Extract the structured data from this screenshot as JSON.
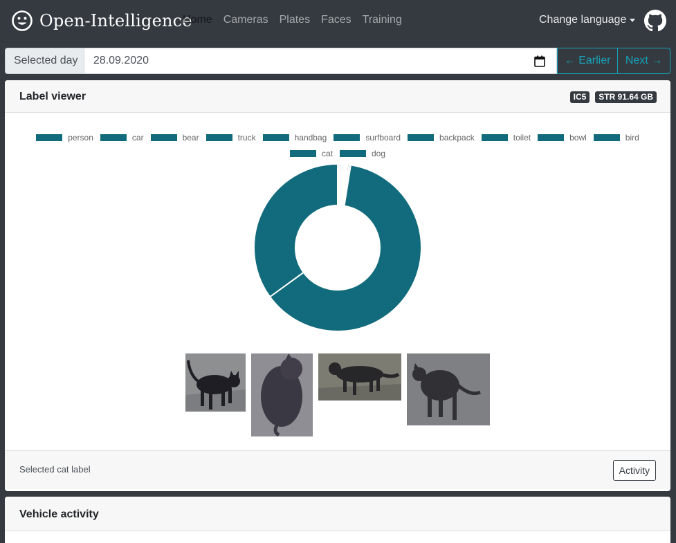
{
  "navbar": {
    "brand": "Open-Intelligence",
    "brand_icon": "smiley-face-icon",
    "links": [
      "Home",
      "Cameras",
      "Plates",
      "Faces",
      "Training"
    ],
    "active_link": "Home",
    "language_label": "Change language",
    "github_icon": "github-icon"
  },
  "date_bar": {
    "prefix": "Selected day",
    "value": "28.09.2020",
    "earlier_label": "← Earlier",
    "next_label": "Next →"
  },
  "label_viewer": {
    "title": "Label viewer",
    "badges": [
      "IC5",
      "STR 91.64 GB"
    ],
    "footer_text": "Selected cat label",
    "activity_button": "Activity",
    "images_alt": [
      "cat image 1",
      "cat image 2",
      "cat image 3",
      "cat image 4"
    ]
  },
  "vehicle_activity": {
    "title": "Vehicle activity"
  },
  "colors": {
    "navbar": "#343a40",
    "accent": "#17a2b8",
    "segment": "#126b7c"
  },
  "chart_data": {
    "type": "pie",
    "donut": true,
    "legend_position": "top",
    "categories": [
      "person",
      "car",
      "bear",
      "truck",
      "handbag",
      "surfboard",
      "backpack",
      "toilet",
      "bowl",
      "bird",
      "cat",
      "dog"
    ],
    "values": [
      0.3,
      0.3,
      0.2,
      0.3,
      0.2,
      0.2,
      0.2,
      0.2,
      0.3,
      0.3,
      62.5,
      35.0
    ],
    "color": "#126b7c"
  }
}
